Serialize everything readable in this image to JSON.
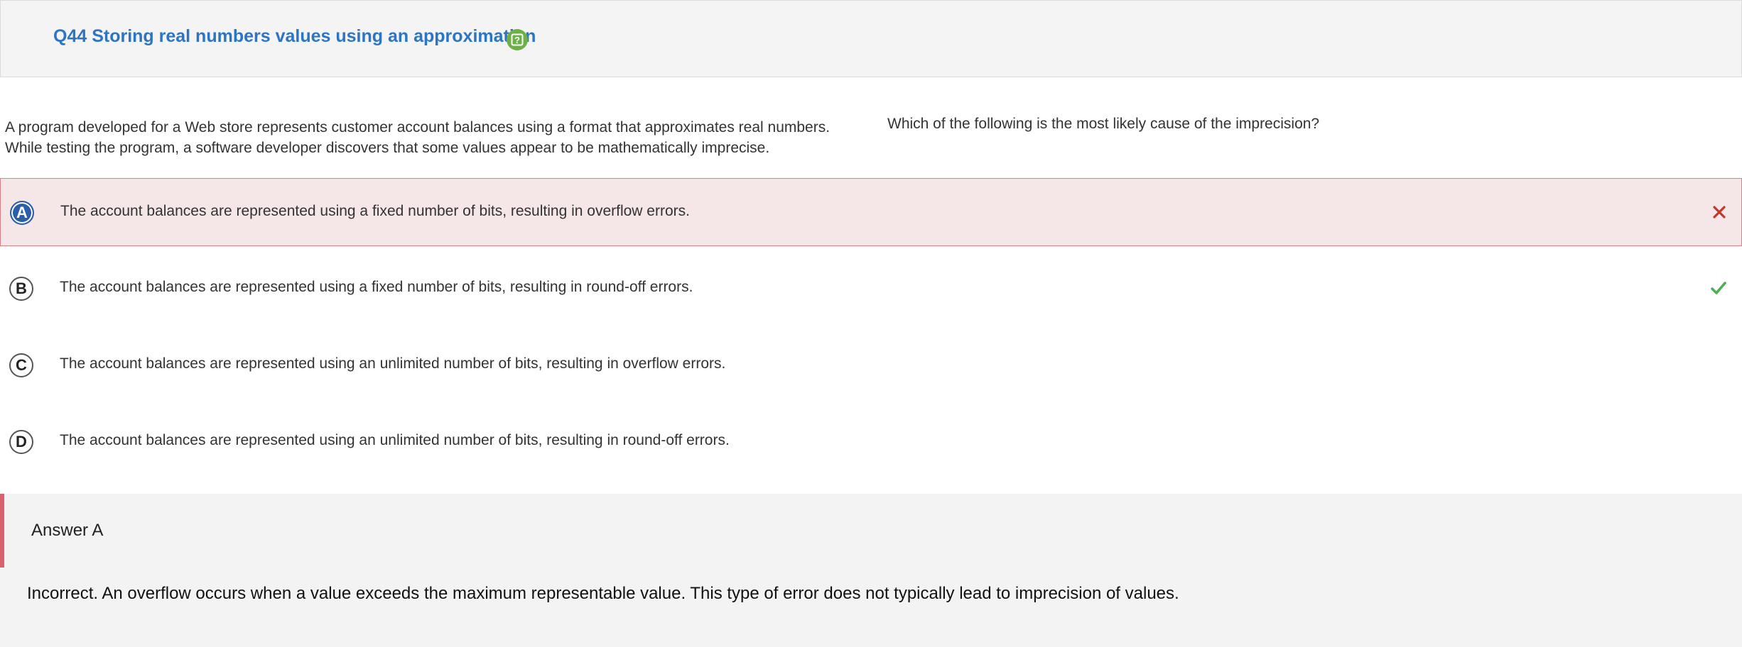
{
  "header": {
    "title": "Q44 Storing real numbers values using an approximation",
    "help_icon": "question-mark-icon",
    "help_icon_color": "#6eb048"
  },
  "stem": {
    "line1": "A program developed for a Web store represents customer account balances using a format that approximates real numbers.",
    "line2": "While testing the program, a software developer discovers that some values appear to be mathematically imprecise."
  },
  "question": "Which of the following is the most likely cause of the imprecision?",
  "options": [
    {
      "letter": "A",
      "text": "The account balances are represented using a fixed number of bits, resulting in overflow errors.",
      "selected": true,
      "status": "incorrect"
    },
    {
      "letter": "B",
      "text": "The account balances are represented using a fixed number of bits, resulting in round-off errors.",
      "selected": false,
      "status": "correct"
    },
    {
      "letter": "C",
      "text": "The account balances are represented using an unlimited number of bits, resulting in overflow errors.",
      "selected": false,
      "status": ""
    },
    {
      "letter": "D",
      "text": "The account balances are represented using an unlimited number of bits, resulting in round-off errors.",
      "selected": false,
      "status": ""
    }
  ],
  "answer": {
    "title": "Answer A",
    "explanation": "Incorrect. An overflow occurs when a value exceeds the maximum representable value. This type of error does not typically lead to imprecision of values."
  },
  "colors": {
    "title_blue": "#2b75c4",
    "incorrect_red": "#c0392b",
    "correct_green": "#4caf50",
    "selected_blue": "#2a5ea8"
  }
}
